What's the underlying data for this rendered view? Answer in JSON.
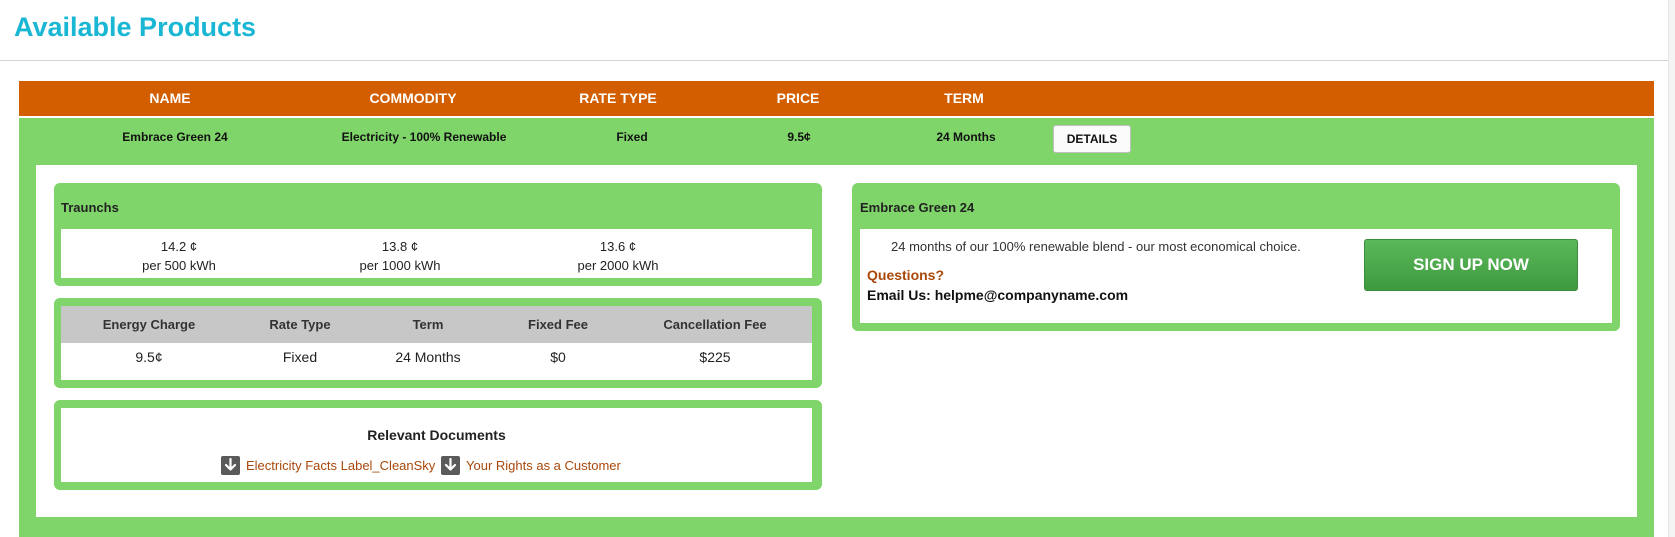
{
  "page": {
    "title": "Available Products"
  },
  "table": {
    "headers": [
      "NAME",
      "COMMODITY",
      "RATE TYPE",
      "PRICE",
      "TERM"
    ],
    "row": {
      "name": "Embrace Green 24",
      "commodity": "Electricity - 100% Renewable",
      "rate_type": "Fixed",
      "price": "9.5¢",
      "term": "24 Months",
      "details_label": "DETAILS"
    }
  },
  "tranches": {
    "title": "Traunchs",
    "items": [
      {
        "price": "14.2 ¢",
        "usage": "per 500 kWh"
      },
      {
        "price": "13.8 ¢",
        "usage": "per 1000 kWh"
      },
      {
        "price": "13.6 ¢",
        "usage": "per 2000 kWh"
      }
    ]
  },
  "summary": {
    "headers": [
      "Energy Charge",
      "Rate Type",
      "Term",
      "Fixed Fee",
      "Cancellation Fee"
    ],
    "values": [
      "9.5¢",
      "Fixed",
      "24 Months",
      "$0",
      "$225"
    ]
  },
  "documents": {
    "title": "Relevant Documents",
    "links": [
      "Electricity Facts Label_CleanSky",
      "Your Rights as a Customer"
    ],
    "icon": "download-icon"
  },
  "plan": {
    "title": "Embrace Green 24",
    "description": "24 months of our 100% renewable blend - our most economical choice.",
    "questions": "Questions?",
    "email_line": "Email Us: helpme@companyname.com",
    "signup_label": "SIGN UP NOW"
  },
  "colors": {
    "title_accent": "#1ab7d5",
    "header_bar": "#d25e00",
    "row_green": "#7fd56a",
    "link_brown": "#a8480a",
    "signup_green": "#4cac4a"
  }
}
